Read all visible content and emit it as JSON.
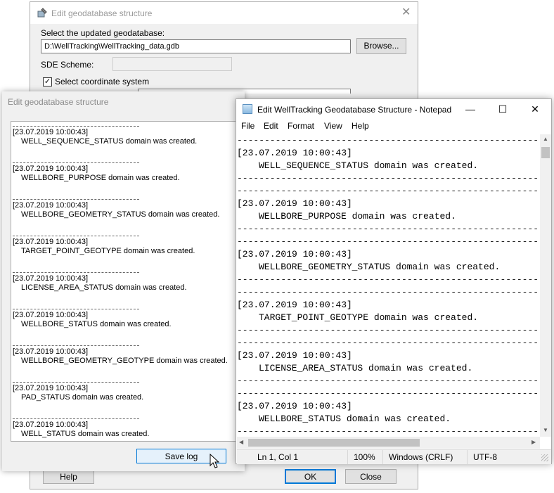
{
  "back_dialog": {
    "title": "Edit geodatabase structure",
    "select_label": "Select the updated geodatabase:",
    "gdb_path": "D:\\WellTracking\\WellTracking_data.gdb",
    "browse_label": "Browse...",
    "sde_label": "SDE Scheme:",
    "coord_label": "Select coordinate system",
    "coord_checked": true,
    "help_label": "Help",
    "ok_label": "OK",
    "close_label": "Close"
  },
  "mid_dialog": {
    "title": "Edit geodatabase structure",
    "save_log_label": "Save log",
    "log": [
      {
        "time": "[23.07.2019 10:00:43]",
        "msg": "WELL_SEQUENCE_STATUS domain was created."
      },
      {
        "time": "[23.07.2019 10:00:43]",
        "msg": "WELLBORE_PURPOSE domain was created."
      },
      {
        "time": "[23.07.2019 10:00:43]",
        "msg": "WELLBORE_GEOMETRY_STATUS domain was created."
      },
      {
        "time": "[23.07.2019 10:00:43]",
        "msg": "TARGET_POINT_GEOTYPE domain was created."
      },
      {
        "time": "[23.07.2019 10:00:43]",
        "msg": "LICENSE_AREA_STATUS domain was created."
      },
      {
        "time": "[23.07.2019 10:00:43]",
        "msg": "WELLBORE_STATUS domain was created."
      },
      {
        "time": "[23.07.2019 10:00:43]",
        "msg": "WELLBORE_GEOMETRY_GEOTYPE domain was created."
      },
      {
        "time": "[23.07.2019 10:00:43]",
        "msg": "PAD_STATUS domain was created."
      },
      {
        "time": "[23.07.2019 10:00:43]",
        "msg": "WELL_STATUS domain was created."
      }
    ]
  },
  "notepad": {
    "title": "Edit WellTracking Geodatabase Structure - Notepad",
    "menu": [
      "File",
      "Edit",
      "Format",
      "View",
      "Help"
    ],
    "entries": [
      {
        "time": "[23.07.2019 10:00:43]",
        "msg": "WELL_SEQUENCE_STATUS domain was created."
      },
      {
        "time": "[23.07.2019 10:00:43]",
        "msg": "WELLBORE_PURPOSE domain was created."
      },
      {
        "time": "[23.07.2019 10:00:43]",
        "msg": "WELLBORE_GEOMETRY_STATUS domain was created."
      },
      {
        "time": "[23.07.2019 10:00:43]",
        "msg": "TARGET_POINT_GEOTYPE domain was created."
      },
      {
        "time": "[23.07.2019 10:00:43]",
        "msg": "LICENSE_AREA_STATUS domain was created."
      },
      {
        "time": "[23.07.2019 10:00:43]",
        "msg": "WELLBORE_STATUS domain was created."
      }
    ],
    "status": {
      "position": "Ln 1, Col 1",
      "zoom": "100%",
      "line_endings": "Windows (CRLF)",
      "encoding": "UTF-8"
    }
  }
}
